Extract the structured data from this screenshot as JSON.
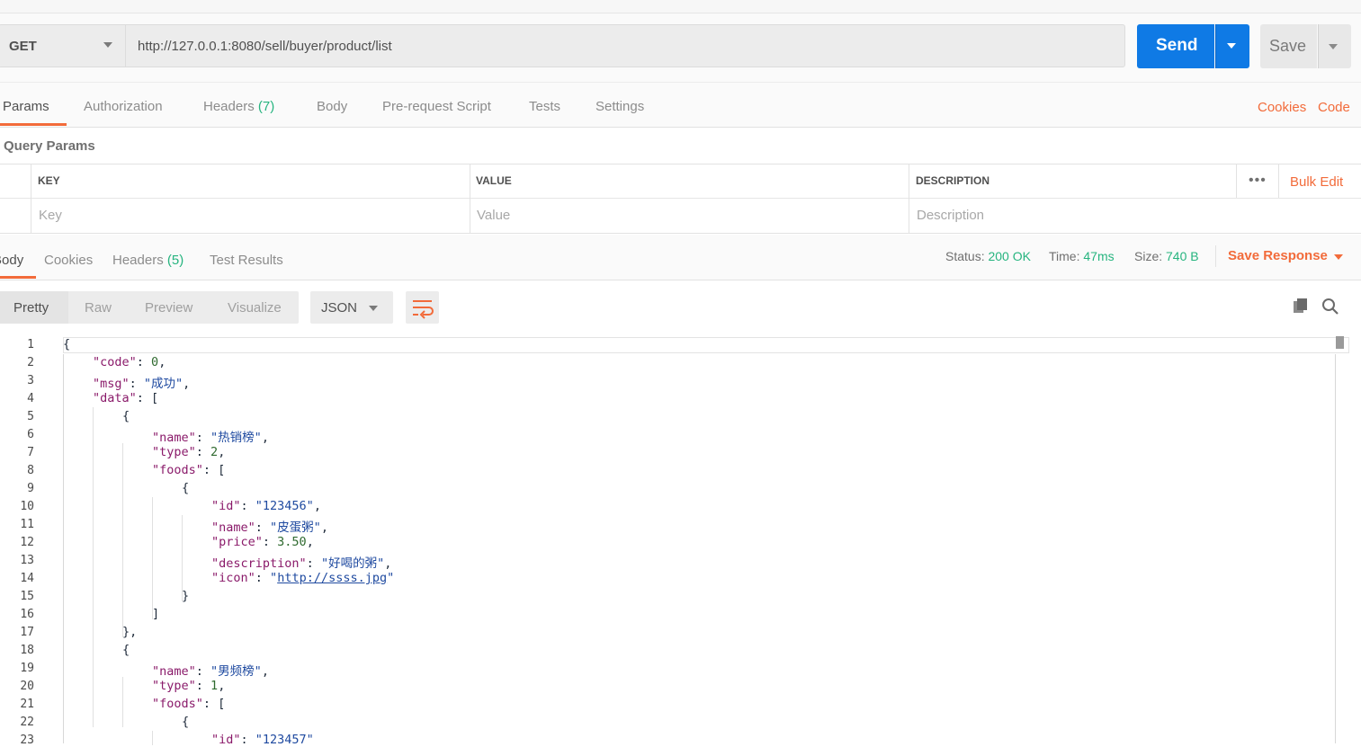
{
  "request": {
    "method": "GET",
    "url": "http://127.0.0.1:8080/sell/buyer/product/list",
    "send_label": "Send",
    "save_label": "Save"
  },
  "request_tabs": [
    {
      "label": "Params",
      "count": ""
    },
    {
      "label": "Authorization",
      "count": ""
    },
    {
      "label": "Headers",
      "count": "(7)"
    },
    {
      "label": "Body",
      "count": ""
    },
    {
      "label": "Pre-request Script",
      "count": ""
    },
    {
      "label": "Tests",
      "count": ""
    },
    {
      "label": "Settings",
      "count": ""
    }
  ],
  "right_links": {
    "cookies": "Cookies",
    "code": "Code"
  },
  "query_params": {
    "title": "Query Params",
    "headers": {
      "key": "KEY",
      "value": "VALUE",
      "description": "DESCRIPTION"
    },
    "placeholders": {
      "key": "Key",
      "value": "Value",
      "description": "Description"
    },
    "bulk_edit": "Bulk Edit",
    "more": "•••"
  },
  "response_tabs": [
    {
      "label": "Body",
      "count": ""
    },
    {
      "label": "Cookies",
      "count": ""
    },
    {
      "label": "Headers",
      "count": "(5)"
    },
    {
      "label": "Test Results",
      "count": ""
    }
  ],
  "response_status": {
    "status_label": "Status:",
    "status_value": "200 OK",
    "time_label": "Time:",
    "time_value": "47ms",
    "size_label": "Size:",
    "size_value": "740 B",
    "save_response": "Save Response"
  },
  "view_modes": [
    "Pretty",
    "Raw",
    "Preview",
    "Visualize"
  ],
  "format": "JSON",
  "colors": {
    "accent": "#f26b3a",
    "send": "#0f7ae5",
    "success": "#26b47f"
  },
  "code_lines": [
    {
      "n": "1",
      "indent": 0,
      "tokens": [
        [
          "p",
          "{"
        ]
      ]
    },
    {
      "n": "2",
      "indent": 1,
      "tokens": [
        [
          "k",
          "\"code\""
        ],
        [
          "p",
          ": "
        ],
        [
          "n",
          "0"
        ],
        [
          "p",
          ","
        ]
      ]
    },
    {
      "n": "3",
      "indent": 1,
      "tokens": [
        [
          "k",
          "\"msg\""
        ],
        [
          "p",
          ": "
        ],
        [
          "s",
          "\"成功\""
        ],
        [
          "p",
          ","
        ]
      ]
    },
    {
      "n": "4",
      "indent": 1,
      "tokens": [
        [
          "k",
          "\"data\""
        ],
        [
          "p",
          ": ["
        ]
      ]
    },
    {
      "n": "5",
      "indent": 2,
      "tokens": [
        [
          "p",
          "{"
        ]
      ]
    },
    {
      "n": "6",
      "indent": 3,
      "tokens": [
        [
          "k",
          "\"name\""
        ],
        [
          "p",
          ": "
        ],
        [
          "s",
          "\"热销榜\""
        ],
        [
          "p",
          ","
        ]
      ]
    },
    {
      "n": "7",
      "indent": 3,
      "tokens": [
        [
          "k",
          "\"type\""
        ],
        [
          "p",
          ": "
        ],
        [
          "n",
          "2"
        ],
        [
          "p",
          ","
        ]
      ]
    },
    {
      "n": "8",
      "indent": 3,
      "tokens": [
        [
          "k",
          "\"foods\""
        ],
        [
          "p",
          ": ["
        ]
      ]
    },
    {
      "n": "9",
      "indent": 4,
      "tokens": [
        [
          "p",
          "{"
        ]
      ]
    },
    {
      "n": "10",
      "indent": 5,
      "tokens": [
        [
          "k",
          "\"id\""
        ],
        [
          "p",
          ": "
        ],
        [
          "s",
          "\"123456\""
        ],
        [
          "p",
          ","
        ]
      ]
    },
    {
      "n": "11",
      "indent": 5,
      "tokens": [
        [
          "k",
          "\"name\""
        ],
        [
          "p",
          ": "
        ],
        [
          "s",
          "\"皮蛋粥\""
        ],
        [
          "p",
          ","
        ]
      ]
    },
    {
      "n": "12",
      "indent": 5,
      "tokens": [
        [
          "k",
          "\"price\""
        ],
        [
          "p",
          ": "
        ],
        [
          "n",
          "3.50"
        ],
        [
          "p",
          ","
        ]
      ]
    },
    {
      "n": "13",
      "indent": 5,
      "tokens": [
        [
          "k",
          "\"description\""
        ],
        [
          "p",
          ": "
        ],
        [
          "s",
          "\"好喝的粥\""
        ],
        [
          "p",
          ","
        ]
      ]
    },
    {
      "n": "14",
      "indent": 5,
      "tokens": [
        [
          "k",
          "\"icon\""
        ],
        [
          "p",
          ": "
        ],
        [
          "s",
          "\""
        ],
        [
          "u",
          "http://ssss.jpg"
        ],
        [
          "s",
          "\""
        ]
      ]
    },
    {
      "n": "15",
      "indent": 4,
      "tokens": [
        [
          "p",
          "}"
        ]
      ]
    },
    {
      "n": "16",
      "indent": 3,
      "tokens": [
        [
          "p",
          "]"
        ]
      ]
    },
    {
      "n": "17",
      "indent": 2,
      "tokens": [
        [
          "p",
          "},"
        ]
      ]
    },
    {
      "n": "18",
      "indent": 2,
      "tokens": [
        [
          "p",
          "{"
        ]
      ]
    },
    {
      "n": "19",
      "indent": 3,
      "tokens": [
        [
          "k",
          "\"name\""
        ],
        [
          "p",
          ": "
        ],
        [
          "s",
          "\"男频榜\""
        ],
        [
          "p",
          ","
        ]
      ]
    },
    {
      "n": "20",
      "indent": 3,
      "tokens": [
        [
          "k",
          "\"type\""
        ],
        [
          "p",
          ": "
        ],
        [
          "n",
          "1"
        ],
        [
          "p",
          ","
        ]
      ]
    },
    {
      "n": "21",
      "indent": 3,
      "tokens": [
        [
          "k",
          "\"foods\""
        ],
        [
          "p",
          ": ["
        ]
      ]
    },
    {
      "n": "22",
      "indent": 4,
      "tokens": [
        [
          "p",
          "{"
        ]
      ]
    },
    {
      "n": "23",
      "indent": 5,
      "tokens": [
        [
          "k",
          "\"id\""
        ],
        [
          "p",
          ": "
        ],
        [
          "s",
          "\"123457\""
        ]
      ]
    }
  ]
}
